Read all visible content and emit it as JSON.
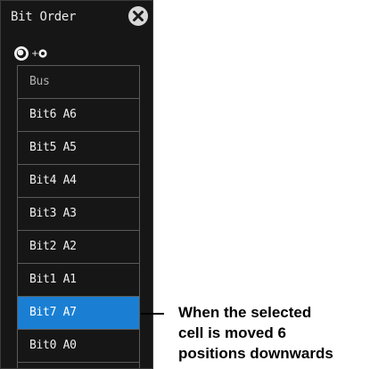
{
  "dialog": {
    "title": "Bit Order",
    "close_icon": "close-circle-icon",
    "jog_hint_icon": "jog-dial-plus-push-icon"
  },
  "list": {
    "items": [
      {
        "label": "Bus",
        "state": "muted"
      },
      {
        "label": "Bit6 A6",
        "state": "normal"
      },
      {
        "label": "Bit5 A5",
        "state": "normal"
      },
      {
        "label": "Bit4 A4",
        "state": "normal"
      },
      {
        "label": "Bit3 A3",
        "state": "normal"
      },
      {
        "label": "Bit2 A2",
        "state": "normal"
      },
      {
        "label": "Bit1 A1",
        "state": "normal"
      },
      {
        "label": "Bit7 A7",
        "state": "selected"
      },
      {
        "label": "Bit0 A0",
        "state": "normal"
      }
    ]
  },
  "annotation": {
    "line1": "When the selected",
    "line2": "cell is moved 6",
    "line3": "positions downwards"
  },
  "colors": {
    "panel_bg": "#161616",
    "selected_bg": "#1a7fd3",
    "border": "#5a5a5a"
  }
}
